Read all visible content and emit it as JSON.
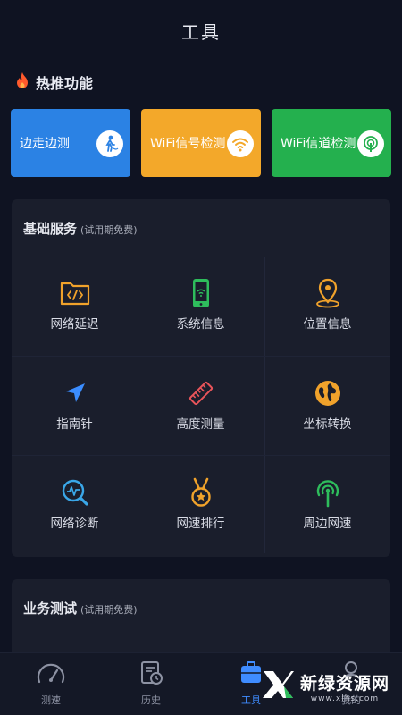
{
  "header": {
    "title": "工具"
  },
  "hot": {
    "label": "热推功能",
    "cards": [
      {
        "label": "边走边测",
        "color": "#2b82e4",
        "icon": "walking-person-icon"
      },
      {
        "label": "WiFi信号检测",
        "color": "#f3a82a",
        "icon": "wifi-icon"
      },
      {
        "label": "WiFi信道检测",
        "color": "#24b04e",
        "icon": "signal-tower-icon"
      }
    ]
  },
  "basic": {
    "title": "基础服务",
    "subtitle": "(试用期免费)",
    "items": [
      {
        "label": "网络延迟",
        "icon": "code-folder-icon"
      },
      {
        "label": "系统信息",
        "icon": "phone-icon"
      },
      {
        "label": "位置信息",
        "icon": "location-pin-icon"
      },
      {
        "label": "指南针",
        "icon": "compass-arrow-icon"
      },
      {
        "label": "高度测量",
        "icon": "ruler-icon"
      },
      {
        "label": "坐标转换",
        "icon": "globe-icon"
      },
      {
        "label": "网络诊断",
        "icon": "diagnosis-magnifier-icon"
      },
      {
        "label": "网速排行",
        "icon": "medal-icon"
      },
      {
        "label": "周边网速",
        "icon": "nearby-signal-icon"
      }
    ]
  },
  "business": {
    "title": "业务测试",
    "subtitle": "(试用期免费)"
  },
  "nav": {
    "items": [
      {
        "label": "测速",
        "icon": "speedometer-icon"
      },
      {
        "label": "历史",
        "icon": "history-icon"
      },
      {
        "label": "工具",
        "icon": "toolbox-icon"
      },
      {
        "label": "我的",
        "icon": "person-icon"
      }
    ]
  },
  "watermark": {
    "main": "新绿资源网",
    "sub": "www.xlhs.com"
  },
  "colors": {
    "background": "#0f1322",
    "panel": "#1a1e2c",
    "accent": "#3f8cff",
    "hot": "#ff5a2c"
  }
}
